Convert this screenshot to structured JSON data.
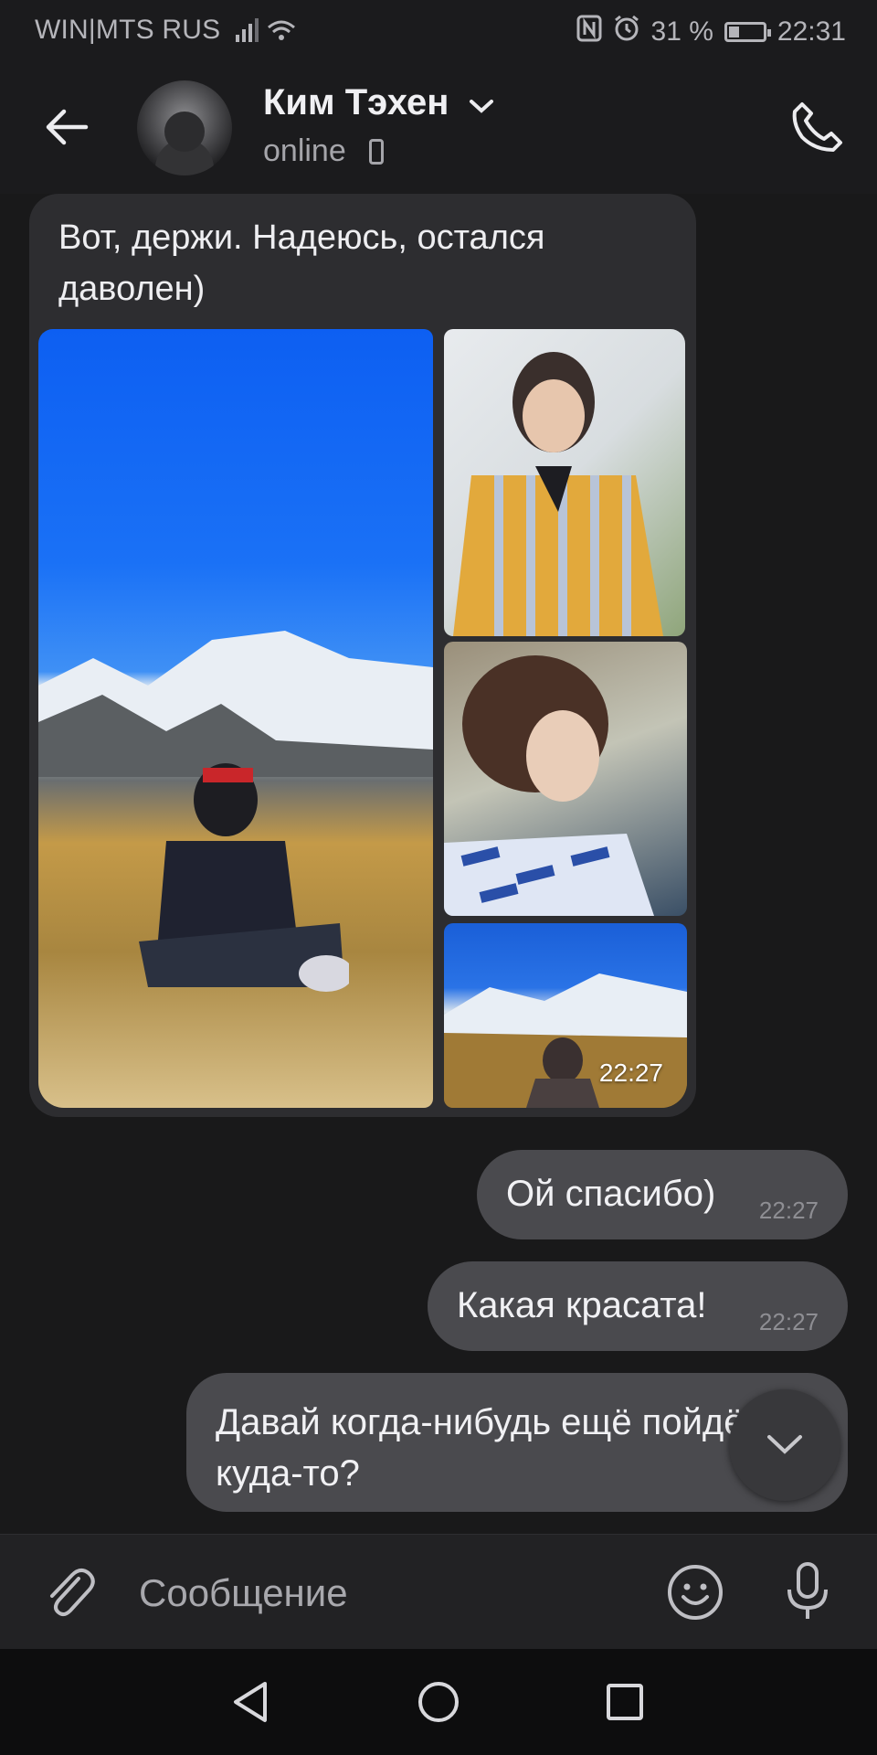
{
  "status_bar": {
    "carrier": "WIN|MTS RUS",
    "battery_percent": "31 %",
    "battery_level": 0.31,
    "time": "22:31"
  },
  "header": {
    "contact_name": "Ким Тэхен",
    "contact_status": "online"
  },
  "messages": {
    "incoming": {
      "text": "Вот, держи. Надеюсь, остался даволен)",
      "photo_time": "22:27"
    },
    "outgoing": [
      {
        "text": "Ой спасибо)",
        "time": "22:27"
      },
      {
        "text": "Какая красата!",
        "time": "22:27"
      },
      {
        "text": "Давай когда-нибудь ещё пойдём куда-то?"
      }
    ]
  },
  "composer": {
    "placeholder": "Сообщение"
  },
  "colors": {
    "background": "#19191a",
    "incoming_bubble": "#2d2d30",
    "outgoing_bubble": "#4a4a4e"
  }
}
